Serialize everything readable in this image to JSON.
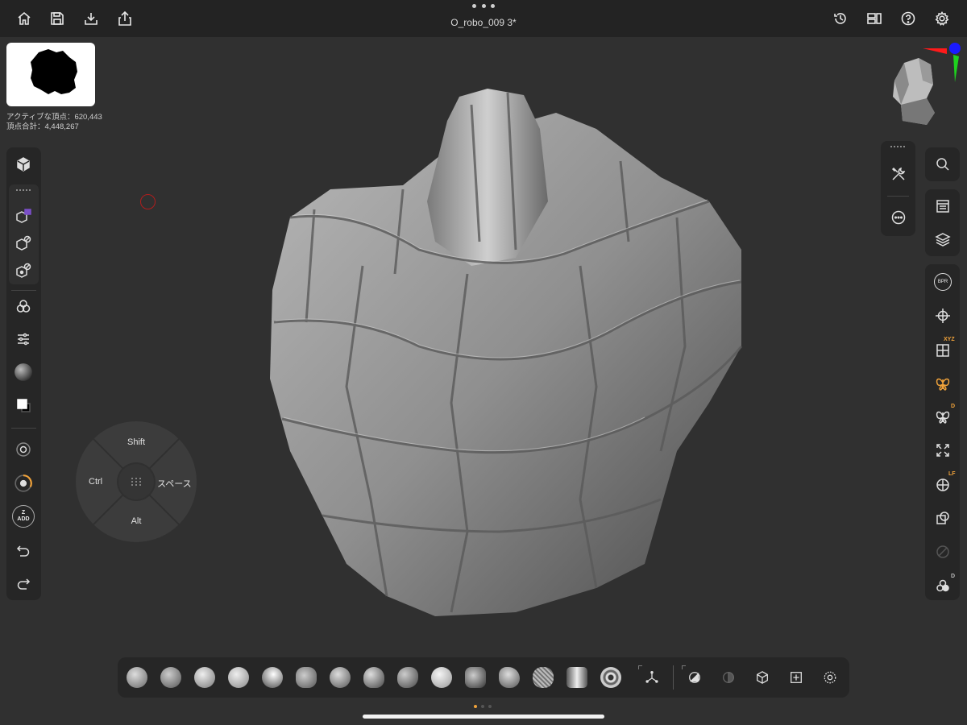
{
  "header": {
    "title": "O_robo_009 3*",
    "left_icons": [
      "home-icon",
      "save-icon",
      "import-icon",
      "export-icon"
    ],
    "right_icons": [
      "history-icon",
      "layout-icon",
      "help-icon",
      "settings-icon"
    ]
  },
  "stats": {
    "active_vertices": "アクティブな頂点：620,443",
    "total_vertices": "頂点合計：4,448,267"
  },
  "left_panel": {
    "icons": [
      "cube-icon",
      "mesh-add-icon",
      "mesh-hide-icon",
      "mesh-hide-2-icon",
      "subtool-icon",
      "sliders-icon",
      "material-sphere-icon",
      "color-swatch-icon",
      "brush-size-icon",
      "brush-intensity-icon",
      "zadd-icon",
      "undo-icon",
      "redo-icon"
    ],
    "zadd_label": "Z\nADD",
    "zadd_top": "Z",
    "zadd_bottom": "ADD"
  },
  "radial_menu": {
    "top": "Shift",
    "left": "Ctrl",
    "right": "スペース",
    "bottom": "Alt"
  },
  "right_small_panel": {
    "icons": [
      "tools-icon",
      "more-icon"
    ]
  },
  "right_panel": {
    "icons": [
      "search-icon",
      "list-icon",
      "layers-icon",
      "bpr-icon",
      "transform-icon",
      "grid-xyz-icon",
      "symmetry-icon",
      "symmetry-d-icon",
      "frame-icon",
      "polyframe-lf-icon",
      "transparency-icon",
      "ghost-icon",
      "solo-d-icon"
    ],
    "bpr_label": "BPR",
    "xyz_badge": "XYZ",
    "d_badge": "D",
    "lf_badge": "LF",
    "d_badge2": "D"
  },
  "bottom_toolbar": {
    "brushes": [
      "clay-buildup",
      "standard",
      "move",
      "smooth",
      "inflate",
      "dam-standard",
      "trim-dynamic",
      "h-polish",
      "pinch",
      "sphere",
      "snakehook",
      "clay",
      "mask-pen",
      "chisel",
      "curl"
    ],
    "tools": [
      "gizmo-icon",
      "material-icon",
      "mask-icon",
      "cube-tool-icon",
      "frame-tool-icon",
      "dynamesh-icon"
    ]
  },
  "colors": {
    "accent": "#f0a23a",
    "background": "#303030",
    "panel": "#262626"
  }
}
